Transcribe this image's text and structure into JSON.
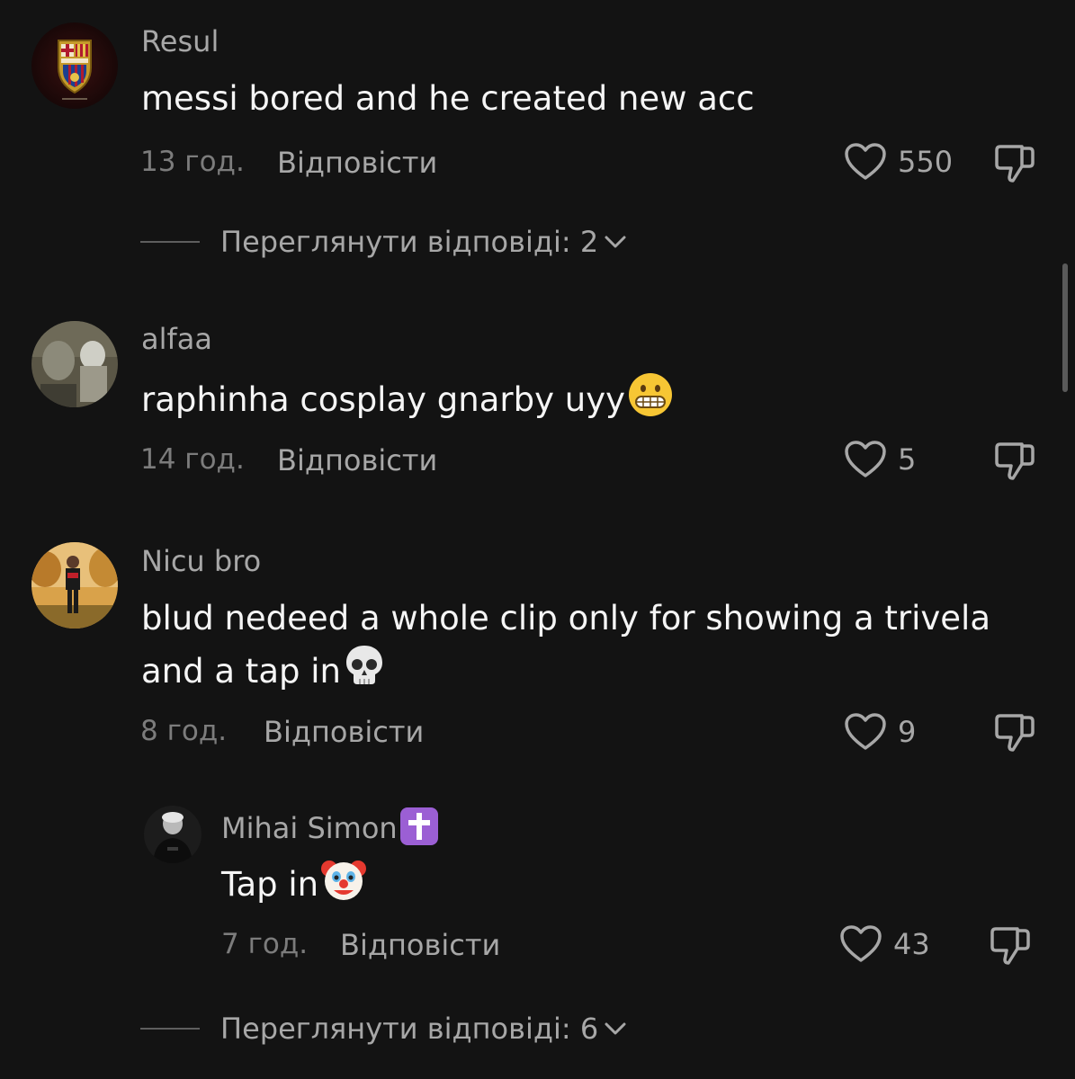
{
  "comments": [
    {
      "username": "Resul",
      "text": "messi bored and he created new acc",
      "time": "13 год.",
      "reply": "Відповісти",
      "likes": "550"
    },
    {
      "username": "alfaa",
      "text": "raphinha cosplay gnarby uyy",
      "emoji": "grimacing-face-emoji",
      "time": "14 год.",
      "reply": "Відповісти",
      "likes": "5"
    },
    {
      "username": "Nicu bro",
      "text": "blud nedeed a whole clip only for showing a trivela and a tap in",
      "emoji": "skull-emoji",
      "time": "8 год.",
      "reply": "Відповісти",
      "likes": "9"
    }
  ],
  "reply": {
    "username": "Mihai Simon",
    "username_emoji": "latin-cross-emoji",
    "text": "Tap in",
    "emoji": "clown-face-emoji",
    "time": "7 год.",
    "reply": "Відповісти",
    "likes": "43"
  },
  "view_replies": [
    {
      "label": "Переглянути відповіді: 2"
    },
    {
      "label": "Переглянути відповіді: 6"
    }
  ],
  "colors": {
    "background": "#131313",
    "primary_text": "#f5f5f5",
    "secondary_text": "#a7a7a7",
    "muted_text": "#7c7c7c"
  }
}
